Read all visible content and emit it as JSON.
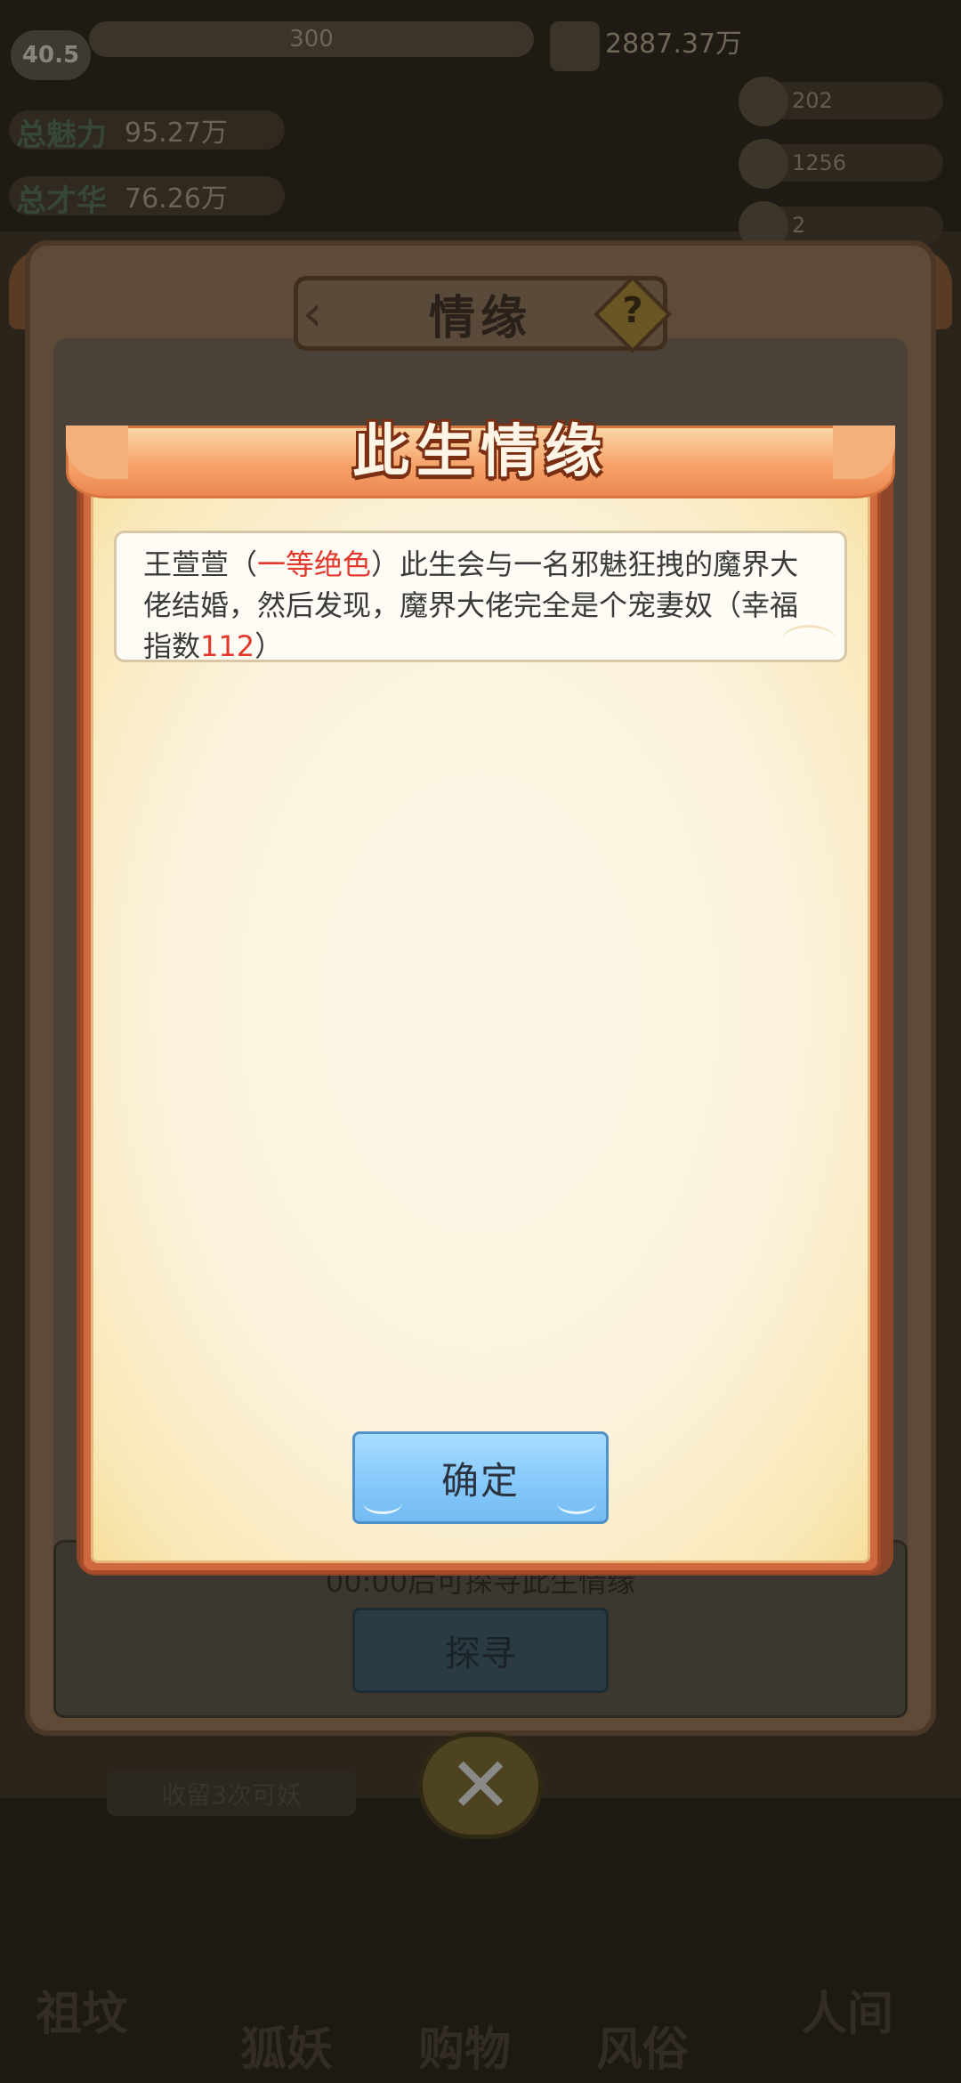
{
  "hud": {
    "level": "40.5",
    "exp": "300",
    "silver": "2887.37万",
    "stat1_tag": "总魅力",
    "stat1_value": "95.27万",
    "stat2_tag": "总才华",
    "stat2_value": "76.26万",
    "res1": "202",
    "res2": "1256",
    "res3": "2"
  },
  "panel": {
    "title": "情缘",
    "help": "?",
    "back": "‹",
    "cooldown_text": "00:00后可探寻此生情缘",
    "seek_button": "探寻",
    "close_icon": "✕",
    "progress_bar": "收留3次可妖"
  },
  "bottom_nav": [
    "祖坟",
    "狐妖",
    "购物",
    "风俗",
    "人间"
  ],
  "dialog": {
    "title": "此生情缘",
    "story": {
      "name": "王萱萱",
      "open_paren": "（",
      "rank": "一等绝色",
      "close_paren": "）",
      "text_line": "此生会与一名邪魅狂拽的魔界大佬结婚，然后发现，魔界大佬完全是个宠妻奴（",
      "happiness_label": "幸福指数",
      "happiness_value": "112",
      "end": "）"
    },
    "confirm_button": "确定"
  },
  "colors": {
    "highlight": "#e3392d",
    "button": "#86c9fb",
    "frame": "#cf6a3e"
  }
}
